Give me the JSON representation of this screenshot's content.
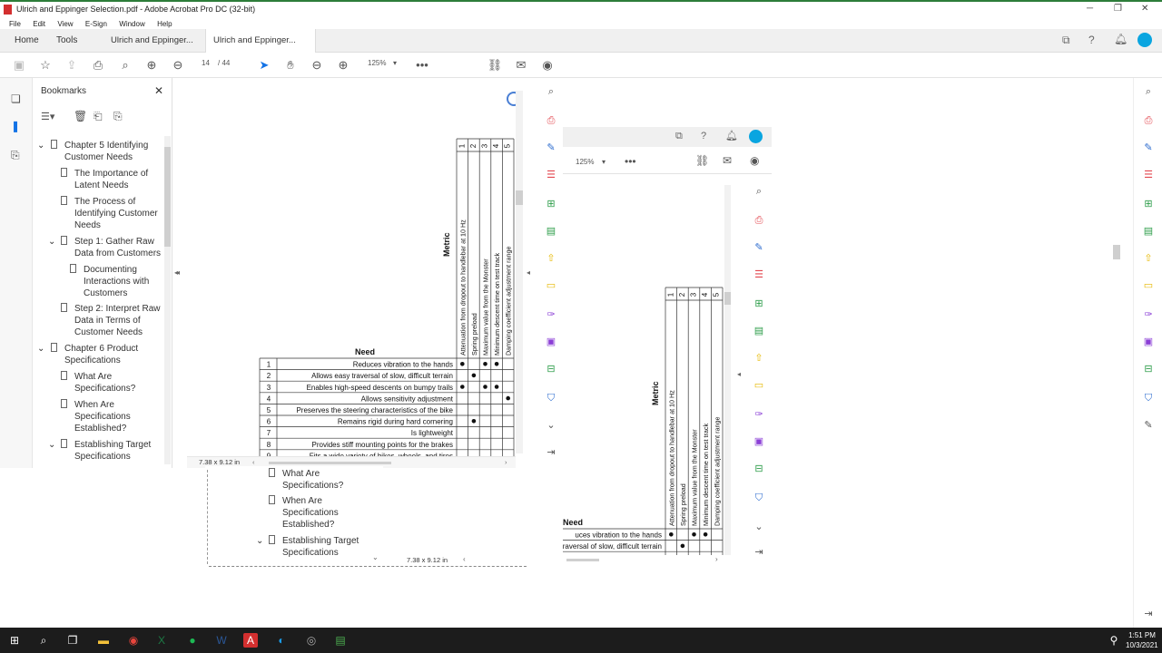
{
  "window": {
    "title": "Ulrich and Eppinger Selection.pdf - Adobe Acrobat Pro DC (32-bit)"
  },
  "menu": [
    "File",
    "Edit",
    "View",
    "E-Sign",
    "Window",
    "Help"
  ],
  "tabs": [
    {
      "label": "Home"
    },
    {
      "label": "Tools"
    },
    {
      "label": "Ulrich and Eppinger..."
    },
    {
      "label": "Ulrich and Eppinger..."
    }
  ],
  "toolbar": {
    "page_current": "14",
    "page_total": "/ 44",
    "zoom": "125%"
  },
  "bookmarks": {
    "title": "Bookmarks",
    "items": [
      {
        "label": "Chapter 5 Identifying Customer Needs"
      },
      {
        "label": "The Importance of Latent Needs"
      },
      {
        "label": "The Process of Identifying Customer Needs"
      },
      {
        "label": "Step 1: Gather Raw Data from Customers"
      },
      {
        "label": "Documenting Interactions with Customers"
      },
      {
        "label": "Step 2: Interpret Raw Data in Terms of Customer Needs"
      },
      {
        "label": "Chapter 6 Product Specifications"
      },
      {
        "label": "What Are Specifications?"
      },
      {
        "label": "When Are Specifications Established?"
      },
      {
        "label": "Establishing Target Specifications"
      }
    ]
  },
  "doc": {
    "page_size": "7.38 x 9.12 in",
    "metric_label": "Metric",
    "need_label": "Need",
    "metric_nums": [
      "1",
      "2",
      "3",
      "4",
      "5"
    ],
    "metrics": [
      "Attenuation from dropout to handlebar at 10 Hz",
      "Spring preload",
      "Maximum value from the Monster",
      "Minimum descent time on test track",
      "Damping coefficient adjustment range"
    ],
    "needs": [
      {
        "n": "1",
        "text": "Reduces vibration to the hands"
      },
      {
        "n": "2",
        "text": "Allows easy traversal of slow, difficult terrain"
      },
      {
        "n": "3",
        "text": "Enables high-speed descents on bumpy trails"
      },
      {
        "n": "4",
        "text": "Allows sensitivity adjustment"
      },
      {
        "n": "5",
        "text": "Preserves the steering characteristics of the bike"
      },
      {
        "n": "6",
        "text": "Remains rigid during hard cornering"
      },
      {
        "n": "7",
        "text": "Is lightweight"
      },
      {
        "n": "8",
        "text": "Provides stiff mounting points for the brakes"
      },
      {
        "n": "9",
        "text": "Fits a wide variety of bikes, wheels, and tires"
      }
    ]
  },
  "nested": {
    "zoom": "125%",
    "need_label": "Need",
    "first_need_partial": "uces vibration to the hands",
    "bookmark_items": [
      {
        "label": "What Are Specifications?"
      },
      {
        "label": "When Are Specifications Established?"
      },
      {
        "label": "Establishing Target Specifications"
      }
    ],
    "page_size": "7.38 x 9.12 in"
  },
  "taskbar": {
    "time": "1:51 PM",
    "date": "10/3/2021"
  },
  "colors": {
    "accent": "#1473e6",
    "tool_red": "#e34850",
    "tool_blue": "#2d6ccf",
    "tool_green": "#2d9d4a",
    "tool_yellow": "#e6b800",
    "tool_purple": "#8b3fd6"
  }
}
